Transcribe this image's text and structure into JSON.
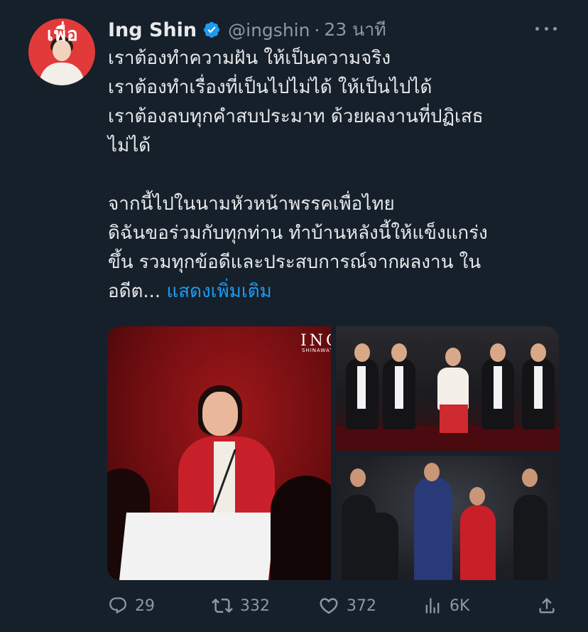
{
  "tweet": {
    "author": {
      "display_name": "Ing Shin",
      "handle": "@ingshin",
      "separator": "·",
      "time": "23 นาที",
      "verified": true,
      "avatar_logo_text": "เพื่อ"
    },
    "body_lines": [
      "เราต้องทำความฝัน ให้เป็นความจริง",
      "เราต้องทำเรื่องที่เป็นไปไม่ได้ ให้เป็นไปได้",
      "เราต้องลบทุกคำสบประมาท ด้วยผลงานที่ปฏิเสธ",
      "ไม่ได้",
      "",
      "จากนี้ไปในนามหัวหน้าพรรคเพื่อไทย",
      "ดิฉันขอร่วมกับทุกท่าน ทำบ้านหลังนี้ให้แข็งแกร่ง",
      "ขึ้น รวมทุกข้อดีและประสบการณ์จากผลงาน ใน"
    ],
    "last_line": "อดีต...",
    "show_more": "แสดงเพิ่มเติม",
    "media": {
      "watermark": "ING",
      "watermark_sub": "SHINAWAT"
    },
    "actions": {
      "replies": "29",
      "retweets": "332",
      "likes": "372",
      "views": "6K"
    }
  },
  "colors": {
    "background": "#15202b",
    "text": "#e7e9ea",
    "secondary": "#8b98a5",
    "link": "#1d9bf0",
    "verified_badge": "#1d9bf0"
  },
  "icons": [
    "verified-badge-icon",
    "more-icon",
    "reply-icon",
    "retweet-icon",
    "like-icon",
    "views-icon",
    "share-icon"
  ]
}
